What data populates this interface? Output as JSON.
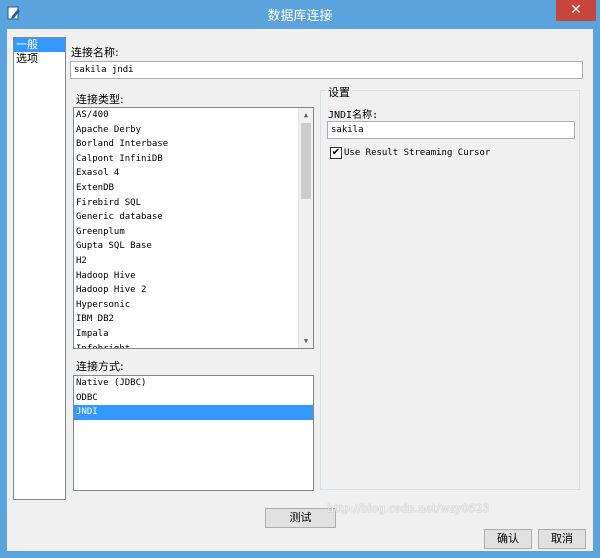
{
  "window": {
    "title": "数据库连接",
    "close_symbol": "✕",
    "icon": "database-edit-icon",
    "titlebar_color": "#5aa3dc",
    "close_color": "#c7463c"
  },
  "nav": {
    "items": [
      {
        "label": "一般",
        "selected": true
      },
      {
        "label": "选项",
        "selected": false
      }
    ]
  },
  "connection_name": {
    "label": "连接名称:",
    "value": "sakila jndi"
  },
  "connection_type": {
    "label": "连接类型:",
    "items": [
      "AS/400",
      "Apache Derby",
      "Borland Interbase",
      "Calpont InfiniDB",
      "Exasol 4",
      "ExtenDB",
      "Firebird SQL",
      "Generic database",
      "Greenplum",
      "Gupta SQL Base",
      "H2",
      "Hadoop Hive",
      "Hadoop Hive 2",
      "Hypersonic",
      "IBM DB2",
      "Impala",
      "Infobright"
    ]
  },
  "access_method": {
    "label": "连接方式:",
    "items": [
      {
        "label": "Native (JDBC)",
        "selected": false
      },
      {
        "label": "ODBC",
        "selected": false
      },
      {
        "label": "JNDI",
        "selected": true
      }
    ]
  },
  "settings": {
    "title": "设置",
    "jndi_label": "JNDI名称:",
    "jndi_value": "sakila",
    "streaming_label": "Use Result Streaming Cursor",
    "streaming_checked": true,
    "check_mark": "✔"
  },
  "buttons": {
    "test": "测试",
    "ok": "确认",
    "cancel": "取消"
  },
  "scroll": {
    "up": "▲",
    "down": "▼"
  },
  "watermark": "http://blog.csdn.net/wzy0623"
}
